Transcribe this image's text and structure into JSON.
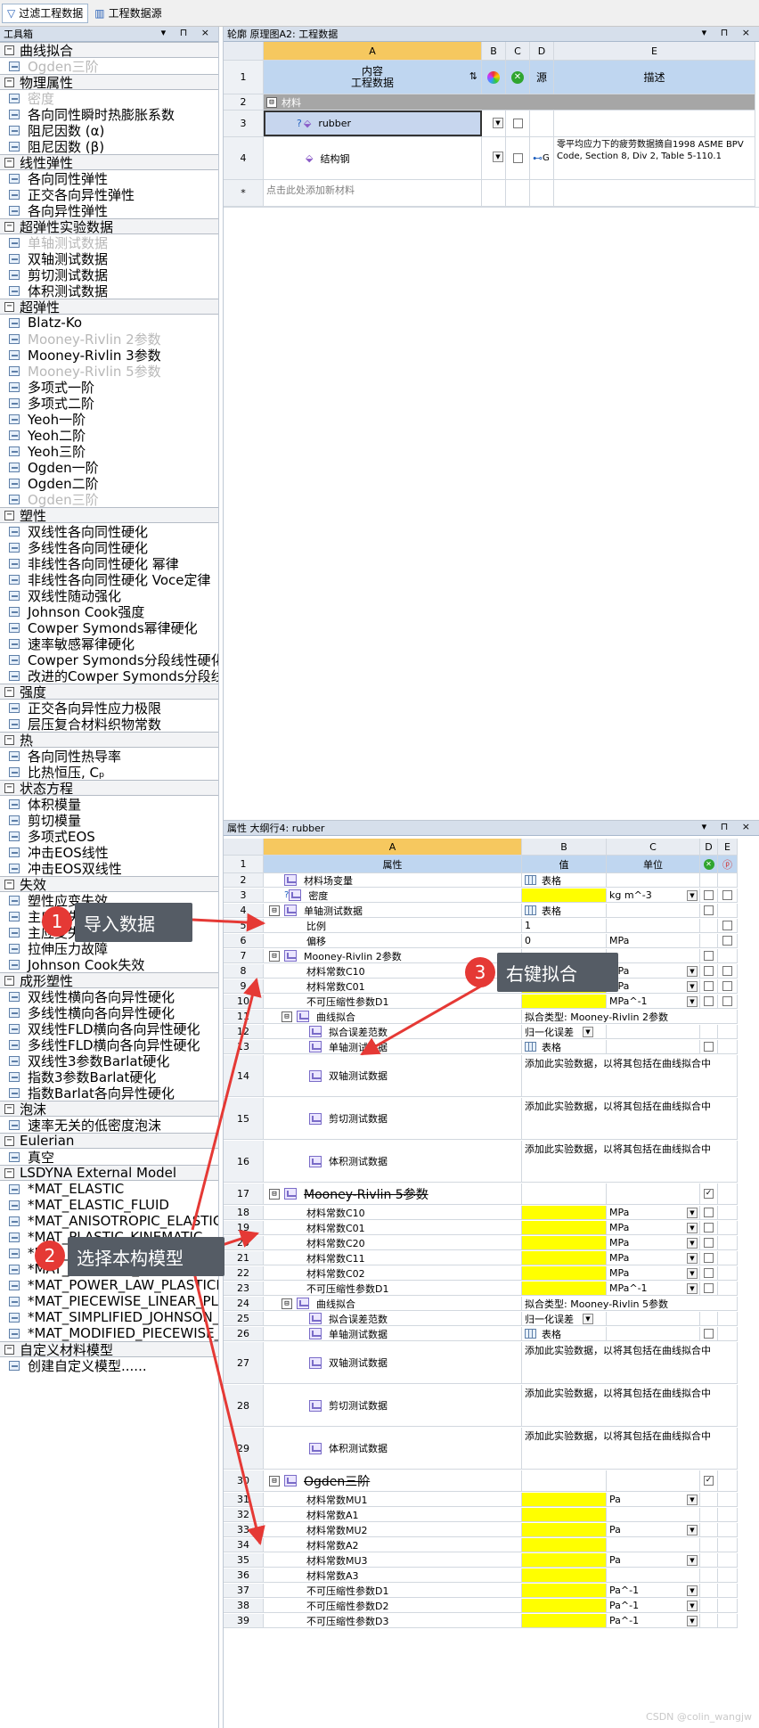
{
  "topbar": {
    "tab1": "过滤工程数据",
    "tab2": "工程数据源"
  },
  "toolbox": {
    "title": "工具箱",
    "controls": "▾ ⊓ ×",
    "categories": [
      {
        "label": "曲线拟合",
        "items": [
          {
            "label": "Ogden三阶",
            "disabled": true
          }
        ]
      },
      {
        "label": "物理属性",
        "items": [
          {
            "label": "密度",
            "disabled": true
          },
          {
            "label": "各向同性瞬时热膨胀系数"
          },
          {
            "label": "阻尼因数 (α)"
          },
          {
            "label": "阻尼因数 (β)"
          }
        ]
      },
      {
        "label": "线性弹性",
        "items": [
          {
            "label": "各向同性弹性"
          },
          {
            "label": "正交各向异性弹性"
          },
          {
            "label": "各向异性弹性"
          }
        ]
      },
      {
        "label": "超弹性实验数据",
        "items": [
          {
            "label": "单轴测试数据",
            "disabled": true
          },
          {
            "label": "双轴测试数据"
          },
          {
            "label": "剪切测试数据"
          },
          {
            "label": "体积测试数据"
          }
        ]
      },
      {
        "label": "超弹性",
        "items": [
          {
            "label": "Blatz-Ko"
          },
          {
            "label": "Mooney-Rivlin 2参数",
            "disabled": true
          },
          {
            "label": "Mooney-Rivlin 3参数"
          },
          {
            "label": "Mooney-Rivlin 5参数",
            "disabled": true
          },
          {
            "label": "多项式一阶"
          },
          {
            "label": "多项式二阶"
          },
          {
            "label": "Yeoh一阶"
          },
          {
            "label": "Yeoh二阶"
          },
          {
            "label": "Yeoh三阶"
          },
          {
            "label": "Ogden一阶"
          },
          {
            "label": "Ogden二阶"
          },
          {
            "label": "Ogden三阶",
            "disabled": true
          }
        ]
      },
      {
        "label": "塑性",
        "items": [
          {
            "label": "双线性各向同性硬化"
          },
          {
            "label": "多线性各向同性硬化"
          },
          {
            "label": "非线性各向同性硬化 幂律"
          },
          {
            "label": "非线性各向同性硬化 Voce定律"
          },
          {
            "label": "双线性随动强化"
          },
          {
            "label": "Johnson Cook强度"
          },
          {
            "label": "Cowper Symonds幂律硬化"
          },
          {
            "label": "速率敏感幂律硬化"
          },
          {
            "label": "Cowper Symonds分段线性硬化"
          },
          {
            "label": "改进的Cowper Symonds分段线性硬化"
          }
        ]
      },
      {
        "label": "强度",
        "items": [
          {
            "label": "正交各向异性应力极限"
          },
          {
            "label": "层压复合材料织物常数"
          }
        ]
      },
      {
        "label": "热",
        "items": [
          {
            "label": "各向同性热导率"
          },
          {
            "label": "比热恒压, Cₚ"
          }
        ]
      },
      {
        "label": "状态方程",
        "items": [
          {
            "label": "体积模量"
          },
          {
            "label": "剪切模量"
          },
          {
            "label": "多项式EOS"
          },
          {
            "label": "冲击EOS线性"
          },
          {
            "label": "冲击EOS双线性"
          }
        ]
      },
      {
        "label": "失效",
        "items": [
          {
            "label": "塑性应变失效"
          },
          {
            "label": "主应力失效"
          },
          {
            "label": "主应变失效"
          },
          {
            "label": "拉伸压力故障"
          },
          {
            "label": "Johnson Cook失效"
          }
        ]
      },
      {
        "label": "成形塑性",
        "items": [
          {
            "label": "双线性横向各向异性硬化"
          },
          {
            "label": "多线性横向各向异性硬化"
          },
          {
            "label": "双线性FLD横向各向异性硬化"
          },
          {
            "label": "多线性FLD横向各向异性硬化"
          },
          {
            "label": "双线性3参数Barlat硬化"
          },
          {
            "label": "指数3参数Barlat硬化"
          },
          {
            "label": "指数Barlat各向异性硬化"
          }
        ]
      },
      {
        "label": "泡沫",
        "items": [
          {
            "label": "速率无关的低密度泡沫"
          }
        ]
      },
      {
        "label": "Eulerian",
        "items": [
          {
            "label": "真空"
          }
        ]
      },
      {
        "label": "LSDYNA External Model",
        "items": [
          {
            "label": "*MAT_ELASTIC"
          },
          {
            "label": "*MAT_ELASTIC_FLUID"
          },
          {
            "label": "*MAT_ANISOTROPIC_ELASTIC"
          },
          {
            "label": "*MAT_PLASTIC_KINEMATIC"
          },
          {
            "label": "*MAT_BLATZ-KO_RUBBER"
          },
          {
            "label": "*MAT_JOHNSON_COOK"
          },
          {
            "label": "*MAT_POWER_LAW_PLASTICITY"
          },
          {
            "label": "*MAT_PIECEWISE_LINEAR_PLASTICITY"
          },
          {
            "label": "*MAT_SIMPLIFIED_JOHNSON_COOK"
          },
          {
            "label": "*MAT_MODIFIED_PIECEWISE_LINEAR"
          }
        ]
      },
      {
        "label": "自定义材料模型",
        "items": [
          {
            "label": "创建自定义模型......"
          }
        ]
      }
    ]
  },
  "engineering": {
    "title": "轮廓 原理图A2: 工程数据",
    "controls": "▾ ⊓ ×",
    "cols": [
      "A",
      "B",
      "C",
      "D",
      "E"
    ],
    "header_a1": "内容",
    "header_a2": "工程数据",
    "header_d": "源",
    "header_e": "描述",
    "group": "材料",
    "rows": [
      {
        "num": "3",
        "name": "rubber",
        "desc": ""
      },
      {
        "num": "4",
        "name": "结构钢",
        "src": "G",
        "desc": "零平均应力下的疲劳数据摘自1998 ASME BPV Code, Section 8, Div 2, Table 5-110.1"
      }
    ],
    "add_row": "点击此处添加新材料",
    "add_row_num": "*"
  },
  "properties": {
    "title": "属性 大纲行4: rubber",
    "controls": "▾ ⊓ ×",
    "cols": [
      "A",
      "B",
      "C",
      "D",
      "E"
    ],
    "col_a": "属性",
    "col_b": "值",
    "col_c": "单位",
    "rows": [
      {
        "n": "2",
        "i": 0,
        "ic": "p",
        "a": "材料场变量",
        "b": "表格",
        "bt": 1
      },
      {
        "n": "3",
        "i": 0,
        "ic": "p",
        "q": 1,
        "a": "密度",
        "y": 1,
        "c": "kg m^-3",
        "cd": 1,
        "d": 1,
        "e": 1
      },
      {
        "n": "4",
        "i": 0,
        "ex": "⊟",
        "ic": "p",
        "a": "单轴测试数据",
        "b": "表格",
        "bt": 1,
        "d": 1
      },
      {
        "n": "5",
        "i": 3,
        "a": "比例",
        "b": "1",
        "e": 1
      },
      {
        "n": "6",
        "i": 3,
        "a": "偏移",
        "b": "0",
        "c": "MPa",
        "e": 1
      },
      {
        "n": "7",
        "i": 0,
        "ex": "⊟",
        "ic": "p",
        "a": "Mooney-Rivlin 2参数",
        "d": 1
      },
      {
        "n": "8",
        "i": 3,
        "a": "材料常数C10",
        "y": 1,
        "c": "MPa",
        "cd": 1,
        "d": 1,
        "e": 1
      },
      {
        "n": "9",
        "i": 3,
        "a": "材料常数C01",
        "y": 1,
        "c": "MPa",
        "cd": 1,
        "d": 1,
        "e": 1
      },
      {
        "n": "10",
        "i": 3,
        "a": "不可压缩性参数D1",
        "y": 1,
        "c": "MPa^-1",
        "cd": 1,
        "d": 1,
        "e": 1
      },
      {
        "n": "11",
        "i": 1,
        "ex": "⊟",
        "ic": "p",
        "a": "曲线拟合",
        "b": "拟合类型: Mooney-Rivlin 2参数",
        "bs": 1
      },
      {
        "n": "12",
        "i": 2,
        "ic": "p",
        "a": "拟合误差范数",
        "b": "归一化误差",
        "bd": 1
      },
      {
        "n": "13",
        "i": 2,
        "ic": "p",
        "a": "单轴测试数据",
        "b": "表格",
        "bt": 1,
        "d": 1
      },
      {
        "n": "14",
        "i": 2,
        "ic": "p",
        "a": "双轴测试数据",
        "b": "添加此实验数据，以将其包括在曲线拟合中",
        "bs": 1,
        "h": 47
      },
      {
        "n": "15",
        "i": 2,
        "ic": "p",
        "a": "剪切测试数据",
        "b": "添加此实验数据，以将其包括在曲线拟合中",
        "bs": 1,
        "h": 47
      },
      {
        "n": "16",
        "i": 2,
        "ic": "p",
        "a": "体积测试数据",
        "b": "添加此实验数据，以将其包括在曲线拟合中",
        "bs": 1,
        "h": 47
      },
      {
        "n": "17",
        "i": 0,
        "ex": "⊟",
        "ic": "p",
        "a": "Mooney-Rivlin 5参数",
        "st": 1,
        "d": 1,
        "dc": 1,
        "h": 24
      },
      {
        "n": "18",
        "i": 3,
        "a": "材料常数C10",
        "y": 1,
        "c": "MPa",
        "cd": 1,
        "d": 1
      },
      {
        "n": "19",
        "i": 3,
        "a": "材料常数C01",
        "y": 1,
        "c": "MPa",
        "cd": 1,
        "d": 1
      },
      {
        "n": "20",
        "i": 3,
        "a": "材料常数C20",
        "y": 1,
        "c": "MPa",
        "cd": 1,
        "d": 1
      },
      {
        "n": "21",
        "i": 3,
        "a": "材料常数C11",
        "y": 1,
        "c": "MPa",
        "cd": 1,
        "d": 1
      },
      {
        "n": "22",
        "i": 3,
        "a": "材料常数C02",
        "y": 1,
        "c": "MPa",
        "cd": 1,
        "d": 1
      },
      {
        "n": "23",
        "i": 3,
        "a": "不可压缩性参数D1",
        "y": 1,
        "c": "MPa^-1",
        "cd": 1,
        "d": 1
      },
      {
        "n": "24",
        "i": 1,
        "ex": "⊟",
        "ic": "p",
        "a": "曲线拟合",
        "b": "拟合类型: Mooney-Rivlin 5参数",
        "bs": 1
      },
      {
        "n": "25",
        "i": 2,
        "ic": "p",
        "a": "拟合误差范数",
        "b": "归一化误差",
        "bd": 1
      },
      {
        "n": "26",
        "i": 2,
        "ic": "p",
        "a": "单轴测试数据",
        "b": "表格",
        "bt": 1,
        "d": 1
      },
      {
        "n": "27",
        "i": 2,
        "ic": "p",
        "a": "双轴测试数据",
        "b": "添加此实验数据，以将其包括在曲线拟合中",
        "bs": 1,
        "h": 47
      },
      {
        "n": "28",
        "i": 2,
        "ic": "p",
        "a": "剪切测试数据",
        "b": "添加此实验数据，以将其包括在曲线拟合中",
        "bs": 1,
        "h": 47
      },
      {
        "n": "29",
        "i": 2,
        "ic": "p",
        "a": "体积测试数据",
        "b": "添加此实验数据，以将其包括在曲线拟合中",
        "bs": 1,
        "h": 47
      },
      {
        "n": "30",
        "i": 0,
        "ex": "⊟",
        "ic": "p",
        "a": "Ogden三阶",
        "st": 1,
        "d": 1,
        "dc": 1,
        "h": 24
      },
      {
        "n": "31",
        "i": 3,
        "a": "材料常数MU1",
        "y": 1,
        "c": "Pa",
        "cd": 1
      },
      {
        "n": "32",
        "i": 3,
        "a": "材料常数A1",
        "y": 1
      },
      {
        "n": "33",
        "i": 3,
        "a": "材料常数MU2",
        "y": 1,
        "c": "Pa",
        "cd": 1
      },
      {
        "n": "34",
        "i": 3,
        "a": "材料常数A2",
        "y": 1
      },
      {
        "n": "35",
        "i": 3,
        "a": "材料常数MU3",
        "y": 1,
        "c": "Pa",
        "cd": 1
      },
      {
        "n": "36",
        "i": 3,
        "a": "材料常数A3",
        "y": 1
      },
      {
        "n": "37",
        "i": 3,
        "a": "不可压缩性参数D1",
        "y": 1,
        "c": "Pa^-1",
        "cd": 1
      },
      {
        "n": "38",
        "i": 3,
        "a": "不可压缩性参数D2",
        "y": 1,
        "c": "Pa^-1",
        "cd": 1
      },
      {
        "n": "39",
        "i": 3,
        "a": "不可压缩性参数D3",
        "y": 1,
        "c": "Pa^-1",
        "cd": 1
      }
    ]
  },
  "annotations": {
    "c1": {
      "num": "1",
      "text": "导入数据"
    },
    "c2": {
      "num": "2",
      "text": "选择本构模型"
    },
    "c3": {
      "num": "3",
      "text": "右键拟合"
    },
    "color": "#e53935"
  },
  "watermark": "CSDN @colin_wangjw"
}
